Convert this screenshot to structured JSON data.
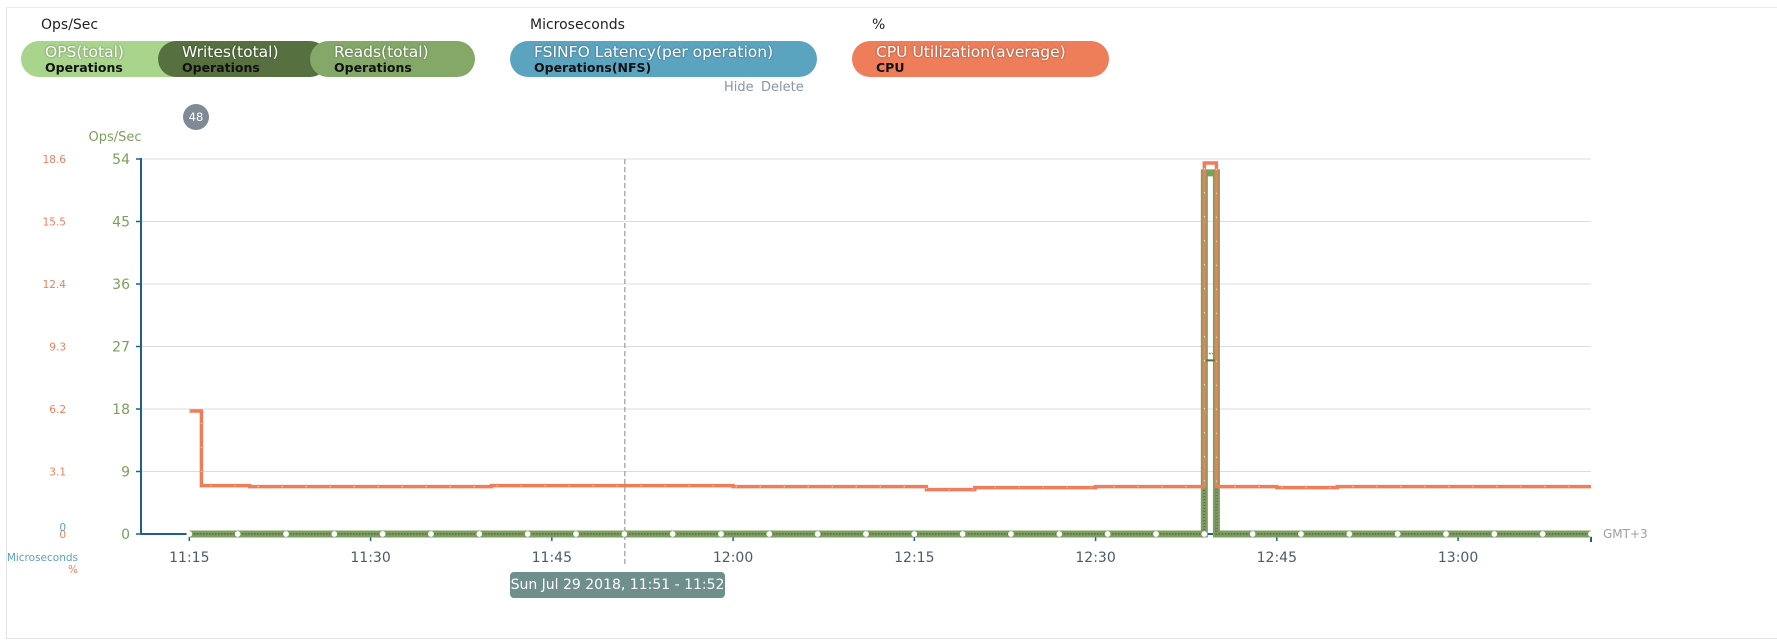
{
  "groups": [
    {
      "title": "Ops/Sec",
      "pills": [
        {
          "name": "OPS(total)",
          "sub": "Operations",
          "color": "#a8d48b"
        },
        {
          "name": "Writes(total)",
          "sub": "Operations",
          "color": "#56703f"
        },
        {
          "name": "Reads(total)",
          "sub": "Operations",
          "color": "#84a868"
        }
      ]
    },
    {
      "title": "Microseconds",
      "pills": [
        {
          "name": "FSINFO Latency(per operation)",
          "sub": "Operations(NFS)",
          "color": "#5ba4c0"
        }
      ]
    },
    {
      "title": "%",
      "pills": [
        {
          "name": "CPU Utilization(average)",
          "sub": "CPU",
          "color": "#ee7e5a"
        }
      ]
    }
  ],
  "actions": {
    "hide": "Hide",
    "delete": "Delete"
  },
  "badge": "48",
  "tooltip": "Sun Jul 29 2018, 11:51 - 11:52",
  "axes": {
    "left_unit": "Ops/Sec",
    "left_ticks": [
      "54",
      "45",
      "36",
      "27",
      "18",
      "9",
      "0"
    ],
    "cpu_ticks": [
      "18.6",
      "15.5",
      "12.4",
      "9.3",
      "6.2",
      "3.1",
      "0"
    ],
    "micro_zero": "0",
    "micro_label": "Microseconds",
    "percent_label": "%",
    "timezone": "GMT+3",
    "x_ticks": [
      "11:15",
      "11:30",
      "11:45",
      "12:00",
      "12:15",
      "12:30",
      "12:45",
      "13:00"
    ]
  },
  "colors": {
    "ops_axis": "#7ba05b",
    "cpu_axis": "#ee7e5a",
    "micro_axis": "#5ba4c0",
    "axis_line": "#1f5f8a",
    "ops_series": "#7ba05b",
    "cpu_series": "#ee7e5a",
    "grid": "#dcdcdc"
  },
  "chart_data": {
    "type": "line",
    "x_range": [
      "11:11",
      "13:11"
    ],
    "ylim_ops": [
      0,
      54
    ],
    "ylim_cpu_percent": [
      0,
      18.6
    ],
    "cursor_time": "11:51",
    "series": [
      {
        "name": "CPU Utilization(average)",
        "axis": "percent",
        "points": [
          [
            "11:15",
            6.1
          ],
          [
            "11:16",
            2.4
          ],
          [
            "11:20",
            2.35
          ],
          [
            "11:30",
            2.35
          ],
          [
            "11:40",
            2.4
          ],
          [
            "11:50",
            2.4
          ],
          [
            "12:00",
            2.35
          ],
          [
            "12:10",
            2.35
          ],
          [
            "12:15",
            2.35
          ],
          [
            "12:16",
            2.2
          ],
          [
            "12:20",
            2.3
          ],
          [
            "12:30",
            2.35
          ],
          [
            "12:38",
            2.35
          ],
          [
            "12:39",
            18.4
          ],
          [
            "12:40",
            2.35
          ],
          [
            "12:45",
            2.3
          ],
          [
            "12:50",
            2.35
          ],
          [
            "13:00",
            2.35
          ],
          [
            "13:11",
            2.35
          ]
        ]
      },
      {
        "name": "OPS(total)",
        "axis": "ops",
        "points": [
          [
            "11:15",
            0
          ],
          [
            "11:30",
            0
          ],
          [
            "11:45",
            0
          ],
          [
            "12:00",
            0
          ],
          [
            "12:15",
            0
          ],
          [
            "12:30",
            0
          ],
          [
            "12:38",
            0
          ],
          [
            "12:39",
            52
          ],
          [
            "12:40",
            0
          ],
          [
            "12:45",
            0
          ],
          [
            "13:00",
            0
          ],
          [
            "13:11",
            0
          ]
        ]
      },
      {
        "name": "Writes(total)",
        "axis": "ops",
        "points": [
          [
            "11:15",
            0
          ],
          [
            "12:38",
            0
          ],
          [
            "12:39",
            25
          ],
          [
            "12:40",
            0
          ],
          [
            "13:11",
            0
          ]
        ]
      },
      {
        "name": "Reads(total)",
        "axis": "ops",
        "points": [
          [
            "11:15",
            0
          ],
          [
            "12:38",
            0
          ],
          [
            "12:39",
            26
          ],
          [
            "12:40",
            0
          ],
          [
            "13:11",
            0
          ]
        ]
      }
    ]
  }
}
